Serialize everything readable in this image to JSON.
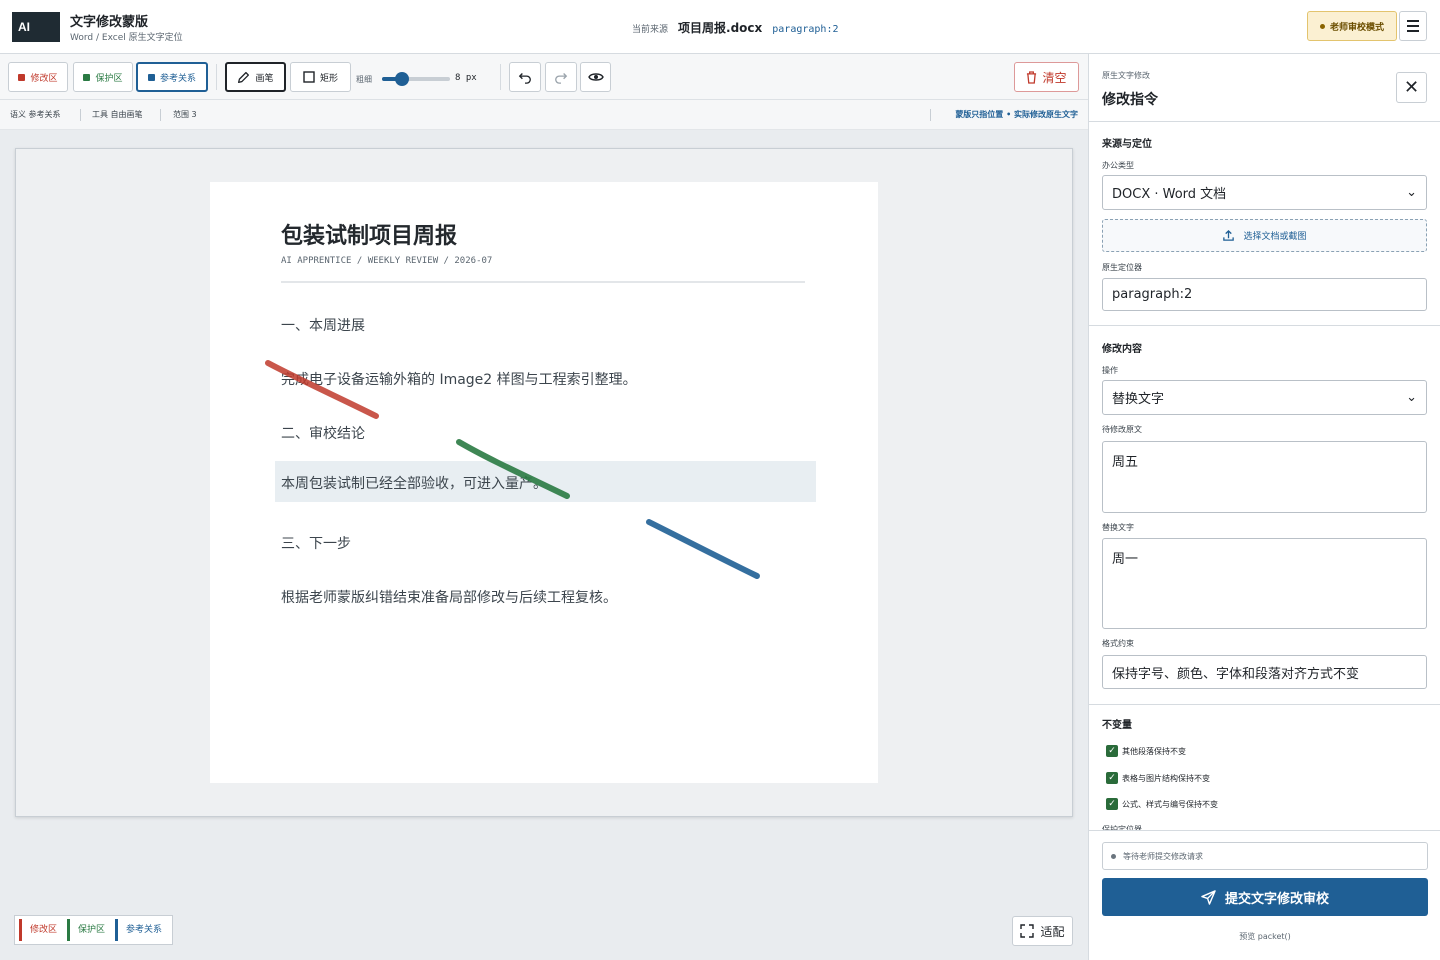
{
  "app": {
    "logo": "AI",
    "title": "文字修改蒙版",
    "subtitle": "Word / Excel 原生文字定位"
  },
  "source": {
    "label": "当前来源",
    "file": "项目周报.docx",
    "locator": "paragraph:2"
  },
  "mode_badge": "老师审校模式",
  "toolbar": {
    "layers": [
      {
        "label": "修改区",
        "color": "#c0392b",
        "icon": "square-icon"
      },
      {
        "label": "保护区",
        "color": "#2a7a43",
        "icon": "square-icon"
      },
      {
        "label": "参考关系",
        "color": "#1f5f95",
        "icon": "square-icon"
      }
    ],
    "pen_label": "画笔",
    "rect_label": "矩形",
    "thickness_label": "粗细",
    "thickness_value": "8 px",
    "thickness_fraction": 0.3,
    "clear_label": "清空"
  },
  "status": {
    "semantic": "语义 参考关系",
    "tool": "工具 自由画笔",
    "range": "范围 3",
    "note": "蒙版只指位置 • 实际修改原生文字"
  },
  "document": {
    "title": "包装试制项目周报",
    "meta": "AI APPRENTICE / WEEKLY REVIEW / 2026-07",
    "paragraphs": [
      "一、本周进展",
      "完成电子设备运输外箱的 Image2 样图与工程索引整理。",
      "二、审校结论",
      "本周包装试制已经全部验收，可进入量产。",
      "三、下一步",
      "根据老师蒙版纠错结束准备局部修改与后续工程复核。"
    ]
  },
  "legend": [
    {
      "label": "修改区",
      "color": "#c0392b"
    },
    {
      "label": "保护区",
      "color": "#2a7a43"
    },
    {
      "label": "参考关系",
      "color": "#1f5f95"
    }
  ],
  "fit_label": "适配",
  "panel": {
    "kicker": "原生文字修改",
    "title": "修改指令",
    "source_section": "来源与定位",
    "office_type_label": "办公类型",
    "office_type_value": "DOCX · Word 文档",
    "upload_label": "选择文档或截图",
    "locator_label": "原生定位器",
    "locator_value": "paragraph:2",
    "change_section": "修改内容",
    "op_label": "操作",
    "op_value": "替换文字",
    "original_label": "待修改原文",
    "original_value": "周五",
    "replace_label": "替换文字",
    "replace_value": "周一",
    "format_label": "格式约束",
    "format_value": "保持字号、颜色、字体和段落对齐方式不变",
    "invariants_section": "不变量",
    "invariants": [
      "其他段落保持不变",
      "表格与图片结构保持不变",
      "公式、样式与编号保持不变"
    ],
    "cutoff_label": "保护定位器",
    "wait_text": "等待老师提交修改请求",
    "submit_label": "提交文字修改审校",
    "preview_label": "预览 packet()"
  }
}
